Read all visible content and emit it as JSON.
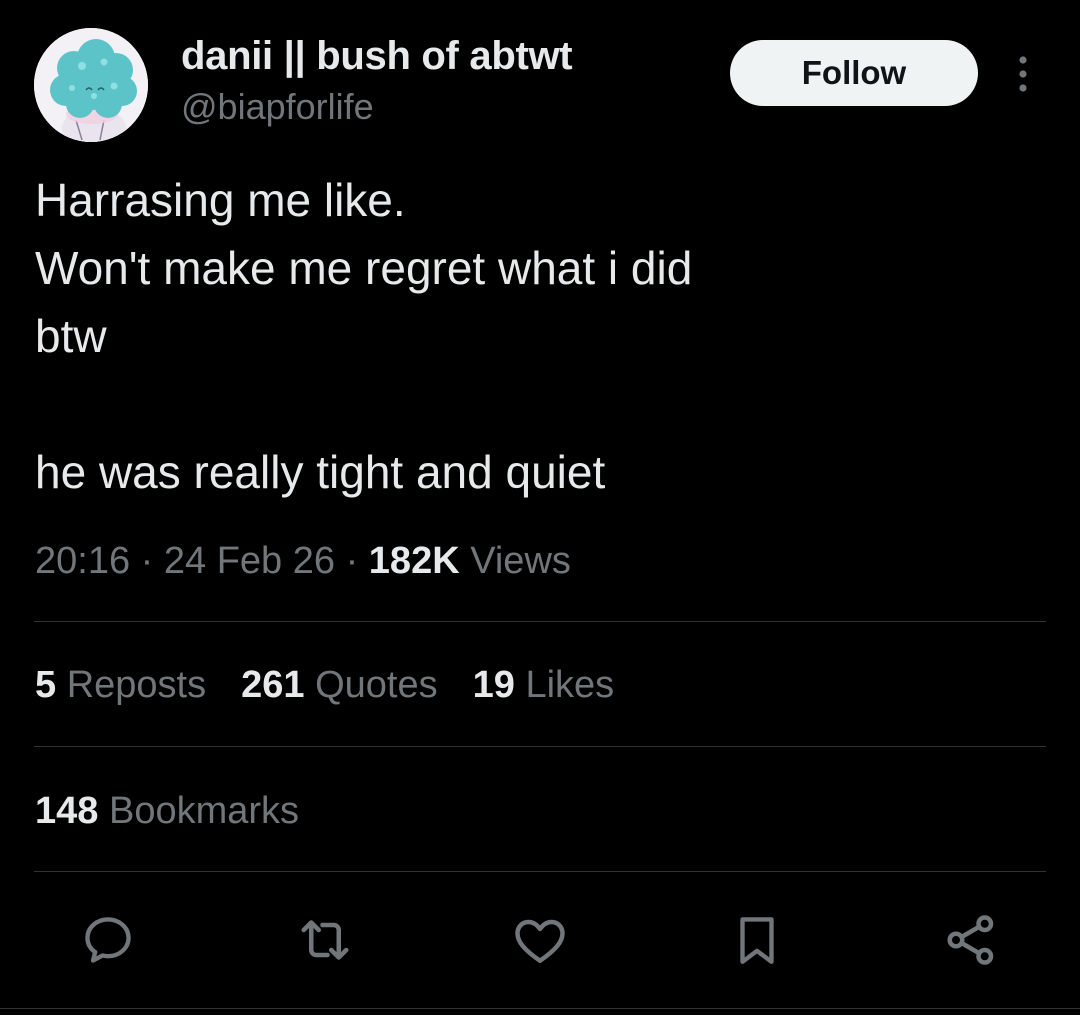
{
  "author": {
    "display_name": "danii || bush of abtwt",
    "handle": "@biapforlife"
  },
  "header": {
    "follow_label": "Follow",
    "more_icon": "more-vertical-icon"
  },
  "tweet": {
    "text": "Harrasing me like.\nWon't make me regret what i did\nbtw\n\nhe was really tight and quiet",
    "time": "20:16",
    "date": "24 Feb 26",
    "separator": "·",
    "views_count": "182K",
    "views_label": "Views"
  },
  "stats": {
    "reposts_count": "5",
    "reposts_label": "Reposts",
    "quotes_count": "261",
    "quotes_label": "Quotes",
    "likes_count": "19",
    "likes_label": "Likes",
    "bookmarks_count": "148",
    "bookmarks_label": "Bookmarks"
  },
  "actions": [
    {
      "icon": "reply-icon"
    },
    {
      "icon": "repost-icon"
    },
    {
      "icon": "like-icon"
    },
    {
      "icon": "bookmark-icon"
    },
    {
      "icon": "share-icon"
    }
  ],
  "colors": {
    "background": "#000000",
    "text_primary": "#e7e9ea",
    "text_secondary": "#71767b",
    "divider": "#2f3336",
    "follow_button_bg": "#eff3f4"
  }
}
